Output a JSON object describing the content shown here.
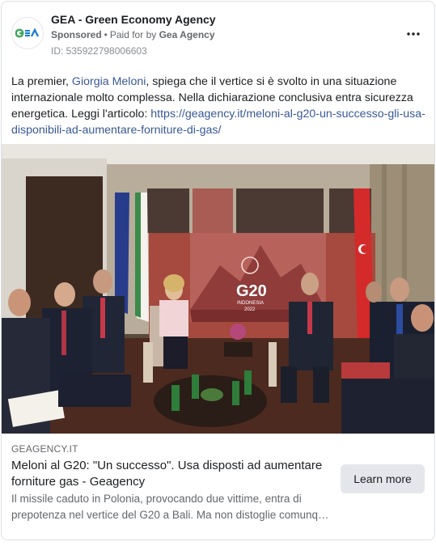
{
  "header": {
    "page_name": "GEA - Green Economy Agency",
    "sponsored_label": "Sponsored",
    "separator": "•",
    "paid_for_prefix": "Paid for by",
    "payer": "Gea Agency",
    "ad_id": "ID: 535922798006603",
    "logo_text": "GEA",
    "brand_colors": {
      "logo_blue": "#1a7fd0",
      "logo_green": "#3aa655"
    }
  },
  "post": {
    "text_before_mention": "La premier, ",
    "mention": "Giorgia Meloni",
    "text_after_mention": ", spiega che il vertice si è svolto in una situazione internazionale molto complessa. Nella dichiarazione conclusiva entra sicurezza energetica. Leggi l'articolo: ",
    "link": "https://geagency.it/meloni-al-g20-un-successo-gli-usa-disponibili-ad-aumentare-forniture-di-gas/"
  },
  "photo": {
    "backdrop_logo": "G20",
    "backdrop_subtitle": "INDONESIA",
    "backdrop_year": "2022"
  },
  "preview": {
    "domain": "GEAGENCY.IT",
    "headline": "Meloni al G20: \"Un successo\". Usa disposti ad aumentare forniture gas - Geagency",
    "description": "Il missile caduto in Polonia, provocando due vittime, entra di prepotenza nel vertice del G20 a Bali. Ma non distoglie comunq…",
    "cta_label": "Learn more"
  },
  "icons": {
    "more": "more-horizontal-icon",
    "logo": "gea-logo-icon"
  }
}
